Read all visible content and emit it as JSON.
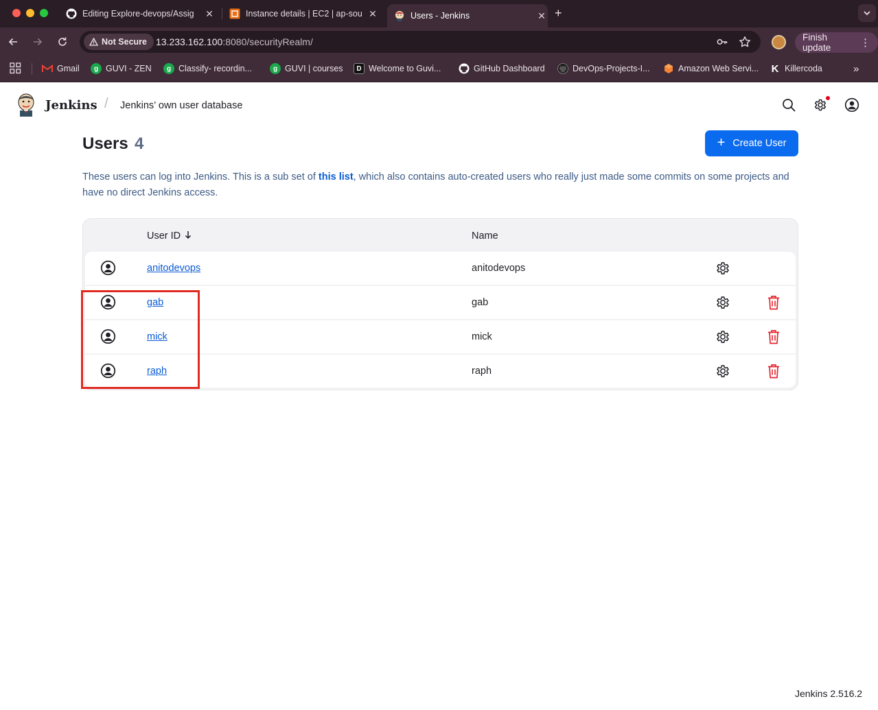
{
  "browser": {
    "tabs": [
      {
        "title": "Editing Explore-devops/Assig",
        "icon": "github-icon"
      },
      {
        "title": "Instance details | EC2 | ap-sou",
        "icon": "aws-ec2-icon"
      },
      {
        "title": "Users - Jenkins",
        "icon": "jenkins-icon",
        "active": true
      }
    ],
    "security_label": "Not Secure",
    "url_host": "13.233.162.100",
    "url_rest": ":8080/securityRealm/",
    "finish_update_label": "Finish update",
    "bookmarks": [
      {
        "label": "Gmail",
        "icon": "gmail-icon",
        "color": "#ea4335"
      },
      {
        "label": "GUVI - ZEN",
        "icon": "guvi-icon",
        "color": "#1ba94c"
      },
      {
        "label": "Classify- recordin...",
        "icon": "guvi-icon",
        "color": "#1ba94c"
      },
      {
        "label": "GUVI | courses",
        "icon": "guvi-icon",
        "color": "#1ba94c"
      },
      {
        "label": "Welcome to Guvi...",
        "icon": "d-icon",
        "color": "#111111"
      },
      {
        "label": "GitHub Dashboard",
        "icon": "github-icon",
        "color": "#ffffff"
      },
      {
        "label": "DevOps-Projects-I...",
        "icon": "github-icon",
        "color": "#ffffff"
      },
      {
        "label": "Amazon Web Servi...",
        "icon": "aws-icon",
        "color": "#f58534"
      },
      {
        "label": "Killercoda",
        "icon": "killercoda-icon",
        "color": "#ffffff"
      }
    ]
  },
  "header": {
    "app_name": "Jenkins",
    "breadcrumb": "Jenkins’ own user database"
  },
  "page": {
    "title": "Users",
    "count": "4",
    "create_button": "Create User",
    "description_before": "These users can log into Jenkins. This is a sub set of ",
    "description_link": "this list",
    "description_after": ", which also contains auto-created users who really just made some commits on some projects and have no direct Jenkins access."
  },
  "table": {
    "columns": {
      "user_id": "User ID",
      "name": "Name"
    },
    "rows": [
      {
        "user_id": "anitodevops",
        "name": "anitodevops",
        "deletable": false
      },
      {
        "user_id": "gab",
        "name": "gab",
        "deletable": true
      },
      {
        "user_id": "mick",
        "name": "mick",
        "deletable": true
      },
      {
        "user_id": "raph",
        "name": "raph",
        "deletable": true
      }
    ]
  },
  "footer": {
    "version": "Jenkins 2.516.2"
  },
  "colors": {
    "accent": "#0b6bef",
    "link": "#0b5cd6",
    "danger": "#e3232b",
    "highlight": "#e02a20"
  }
}
